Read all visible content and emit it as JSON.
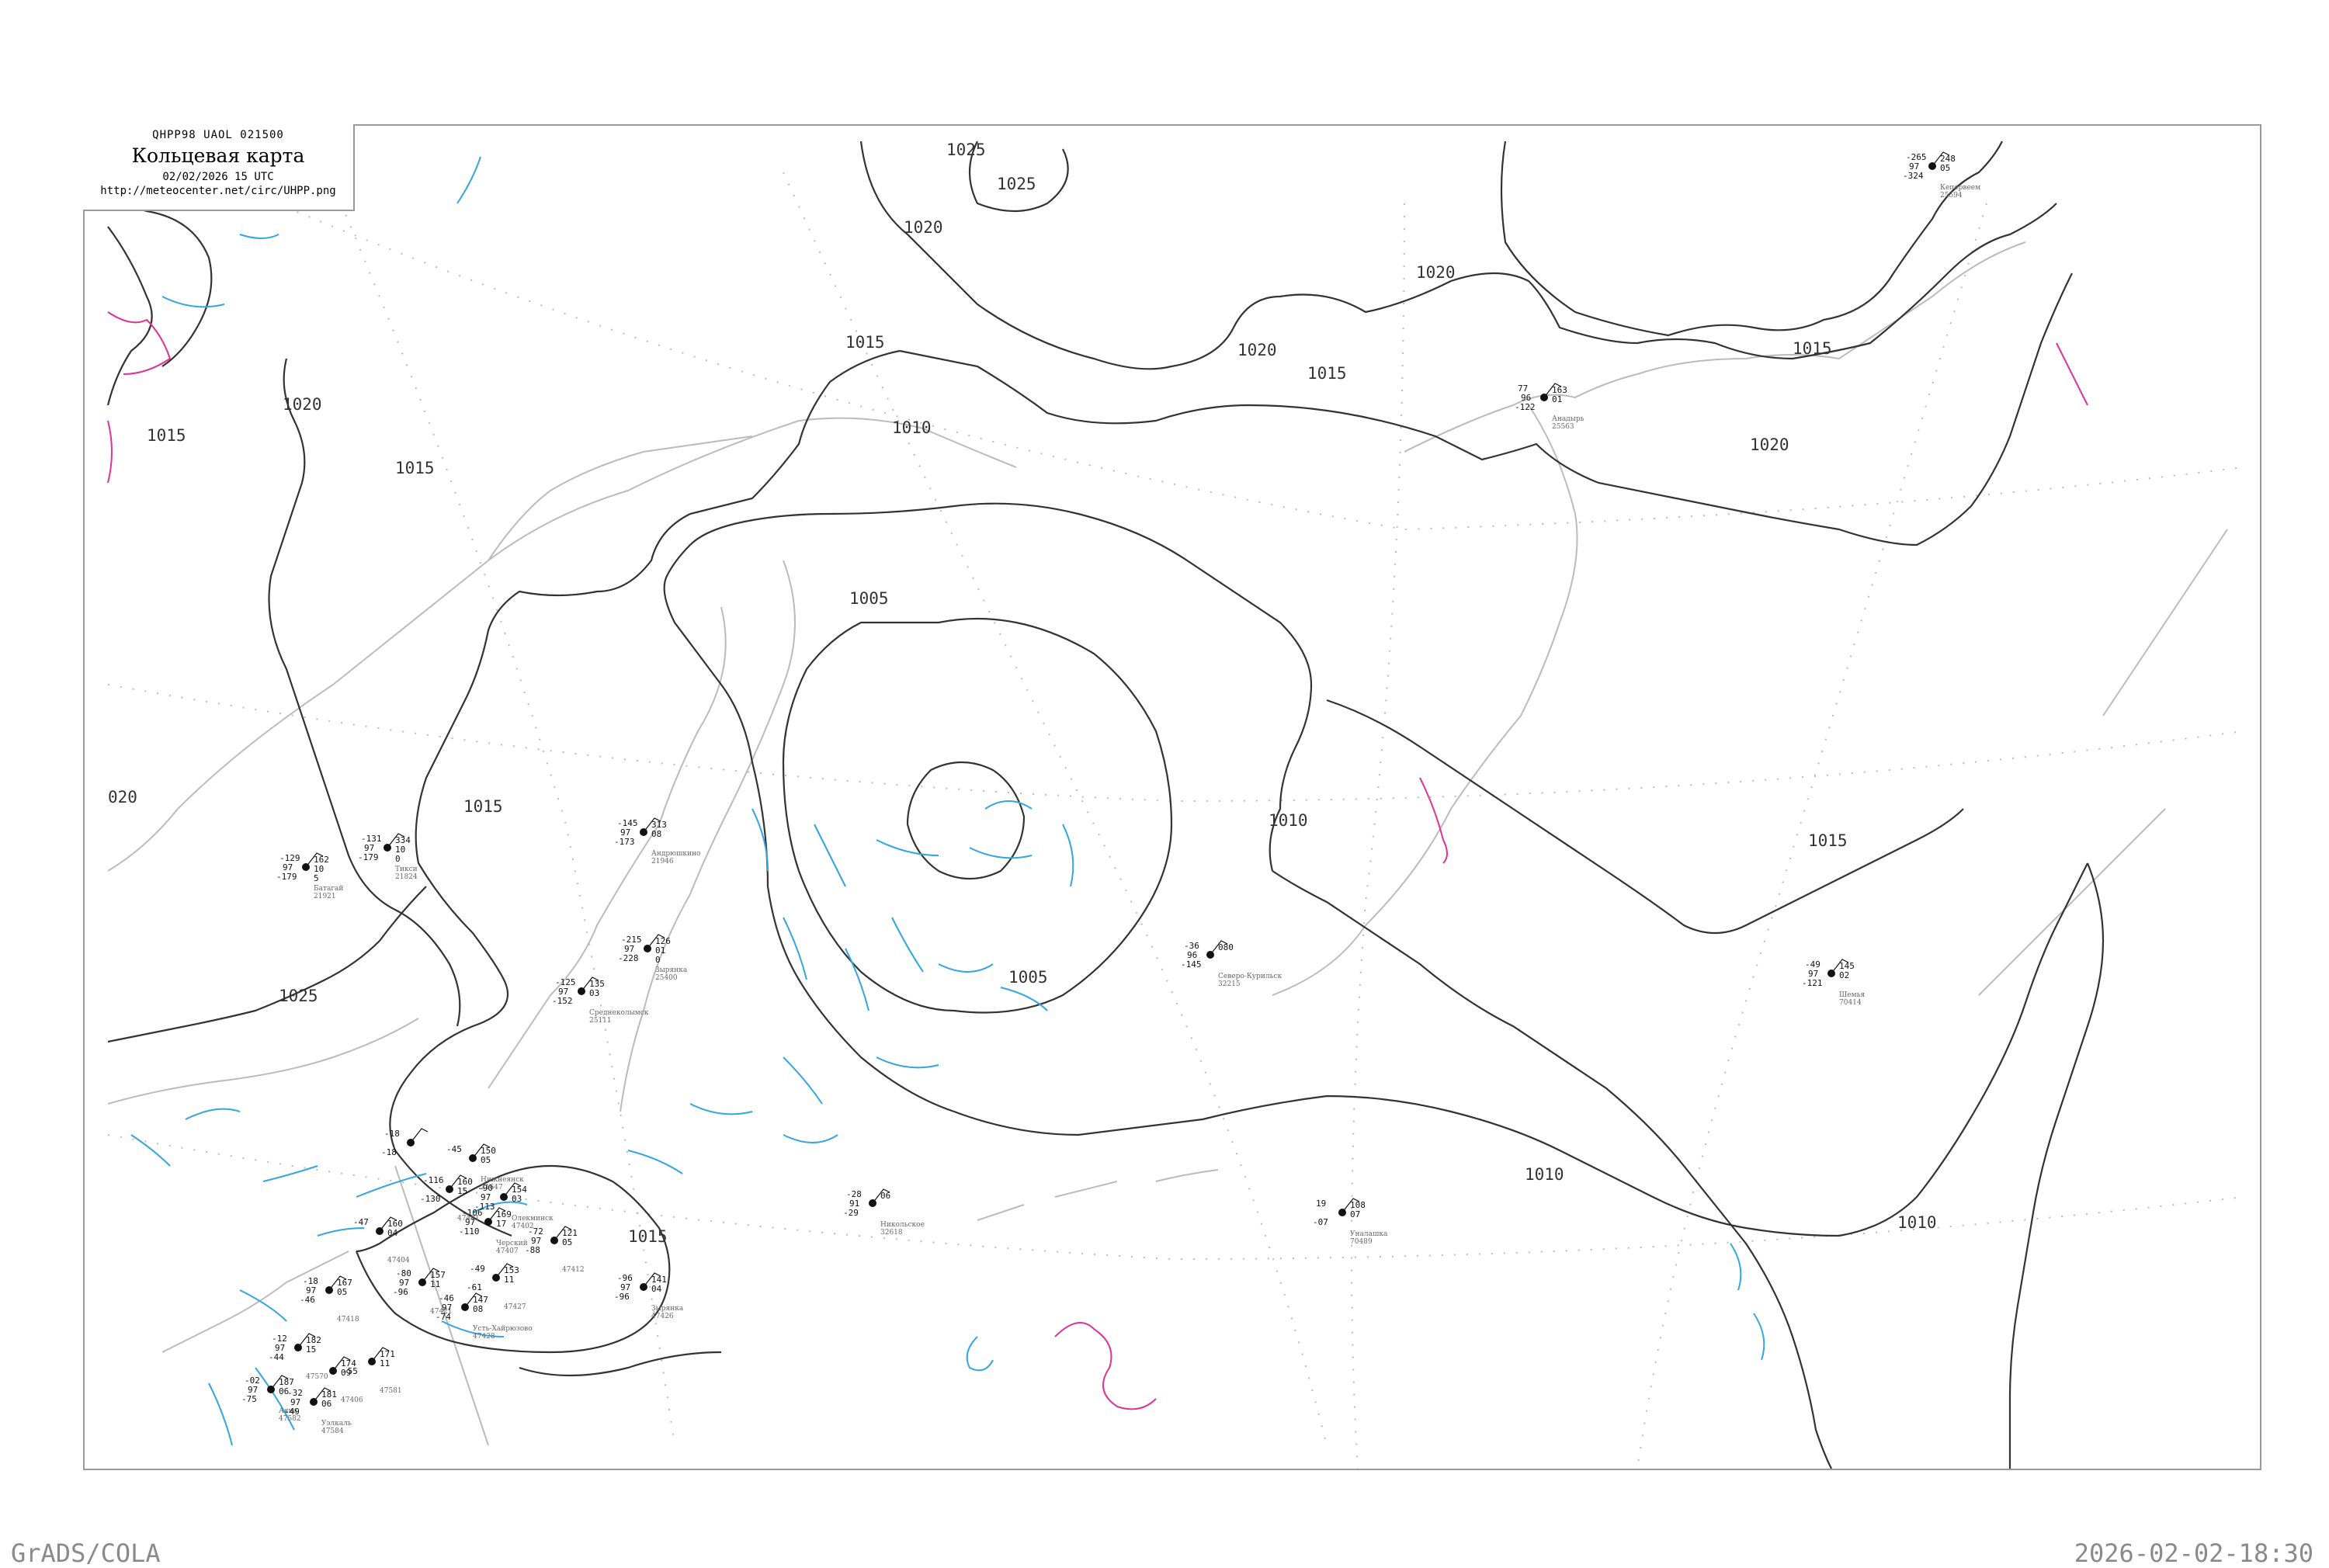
{
  "header": {
    "code": "QHPP98  UAOL  021500",
    "title": "Кольцевая карта",
    "date": "02/02/2026 15 UTC",
    "url": "http://meteocenter.net/circ/UHPP.png"
  },
  "footer": {
    "left": "GrADS/COLA",
    "right": "2026-02-02-18:30"
  },
  "colors": {
    "isobar": "#333333",
    "coast": "#bbbbbb",
    "cold_isotherm": "#33a6e0",
    "warm_isotherm": "#dd3399",
    "grid": "#bbbbbb"
  },
  "isobar_labels": [
    {
      "text": "1025"
    },
    {
      "text": "1025"
    },
    {
      "text": "1020"
    },
    {
      "text": "1020"
    },
    {
      "text": "1020"
    },
    {
      "text": "1020"
    },
    {
      "text": "1015"
    },
    {
      "text": "1015"
    },
    {
      "text": "1015"
    },
    {
      "text": "1025"
    },
    {
      "text": "1010"
    },
    {
      "text": "1005"
    },
    {
      "text": "1005"
    },
    {
      "text": "1010"
    },
    {
      "text": "1015"
    },
    {
      "text": "1010"
    },
    {
      "text": "1015"
    },
    {
      "text": "1015"
    },
    {
      "text": "1025"
    },
    {
      "text": "1020"
    },
    {
      "text": "1010"
    },
    {
      "text": "020"
    },
    {
      "text": "1015"
    }
  ],
  "stations": [
    {
      "top": "-131",
      "left": "97",
      "bottom": "-179",
      "p": "334",
      "t2": "10",
      "t3": "0",
      "name": "Тикси",
      "id": "21824"
    },
    {
      "top": "-129",
      "left": "97",
      "bottom": "-179",
      "p": "162",
      "t2": "10",
      "t3": "5",
      "name": "Батагай",
      "id": "21921"
    },
    {
      "top": "-145",
      "left": "97",
      "bottom": "-173",
      "p": "313",
      "t2": "08",
      "t3": "",
      "name": "Андрюшкино",
      "id": "21946"
    },
    {
      "top": "-215",
      "left": "97",
      "bottom": "-228",
      "p": "126",
      "t2": "01",
      "t3": "0",
      "name": "Зырянка",
      "id": "25400"
    },
    {
      "top": "-125",
      "left": "97",
      "bottom": "-152",
      "p": "135",
      "t2": "03",
      "t3": "",
      "name": "Среднеколымск",
      "id": "25111"
    },
    {
      "top": "77",
      "left": "96",
      "bottom": "-122",
      "p": "163",
      "t2": "01",
      "t3": "",
      "name": "Анадырь",
      "id": "25563"
    },
    {
      "top": "-265",
      "left": "97",
      "bottom": "-324",
      "p": "248",
      "t2": "05",
      "t3": "",
      "name": "Кепервеем",
      "id": "25594"
    },
    {
      "top": "-36",
      "left": "96",
      "bottom": "-145",
      "p": "080",
      "t2": "",
      "t3": "",
      "name": "Северо-Курильск",
      "id": "32215"
    },
    {
      "top": "-49",
      "left": "97",
      "bottom": "-121",
      "p": "145",
      "t2": "02",
      "t3": "",
      "name": "Шемья",
      "id": "70414"
    },
    {
      "top": "-28",
      "left": "91",
      "bottom": "-29",
      "p": "06",
      "t2": "",
      "t3": "",
      "name": "Никольское",
      "id": "32618"
    },
    {
      "top": "19",
      "left": "",
      "bottom": "-07",
      "p": "108",
      "t2": "07",
      "t3": "",
      "name": "Уналашка",
      "id": "70489"
    },
    {
      "top": "-45",
      "left": "",
      "bottom": "",
      "p": "150",
      "t2": "05",
      "t3": "",
      "name": "Нижнеянск",
      "id": "21647"
    },
    {
      "top": "-47",
      "left": "",
      "bottom": "",
      "p": "160",
      "t2": "04",
      "t3": "",
      "name": "",
      "id": "47404"
    },
    {
      "top": "-106",
      "left": "97",
      "bottom": "-110",
      "p": "169",
      "t2": "17",
      "t3": "",
      "name": "Черский",
      "id": "47407"
    },
    {
      "top": "-72",
      "left": "97",
      "bottom": "-88",
      "p": "121",
      "t2": "05",
      "t3": "",
      "name": "",
      "id": "47412"
    },
    {
      "top": "-96",
      "left": "97",
      "bottom": "-96",
      "p": "141",
      "t2": "04",
      "t3": "",
      "name": "Зырянка",
      "id": "47426"
    },
    {
      "top": "-49",
      "left": "",
      "bottom": "-61",
      "p": "153",
      "t2": "11",
      "t3": "",
      "name": "",
      "id": "47427"
    },
    {
      "top": "-18",
      "left": "97",
      "bottom": "-46",
      "p": "167",
      "t2": "05",
      "t3": "",
      "name": "",
      "id": "47418"
    },
    {
      "top": "-12",
      "left": "97",
      "bottom": "-44",
      "p": "182",
      "t2": "15",
      "t3": "",
      "name": "",
      "id": "47570"
    },
    {
      "top": "-02",
      "left": "97",
      "bottom": "-75",
      "p": "187",
      "t2": "06",
      "t3": "",
      "name": "Аяна",
      "id": "47582"
    },
    {
      "top": "-32",
      "left": "97",
      "bottom": "-49",
      "p": "181",
      "t2": "06",
      "t3": "",
      "name": "Уэлкаль",
      "id": "47584"
    },
    {
      "top": "",
      "left": "",
      "bottom": "-55",
      "p": "171",
      "t2": "11",
      "t3": "",
      "name": "",
      "id": "47581"
    },
    {
      "top": "-80",
      "left": "97",
      "bottom": "-96",
      "p": "157",
      "t2": "11",
      "t3": "",
      "name": "",
      "id": "47421"
    },
    {
      "top": "-46",
      "left": "97",
      "bottom": "-74",
      "p": "147",
      "t2": "08",
      "t3": "",
      "name": "Усть-Хайрюзово",
      "id": "47428"
    },
    {
      "top": "-18",
      "left": "",
      "bottom": "-18",
      "p": "",
      "t2": "",
      "t3": "",
      "name": "",
      "id": ""
    },
    {
      "top": "-90",
      "left": "97",
      "bottom": "-113",
      "p": "154",
      "t2": "03",
      "t3": "",
      "name": "Олекминск",
      "id": "47402"
    },
    {
      "top": "",
      "left": "",
      "bottom": "",
      "p": "174",
      "t2": "09",
      "t3": "",
      "name": "",
      "id": "47406"
    },
    {
      "top": "-116",
      "left": "",
      "bottom": "-130",
      "p": "160",
      "t2": "15",
      "t3": "",
      "name": "",
      "id": "47401"
    }
  ]
}
